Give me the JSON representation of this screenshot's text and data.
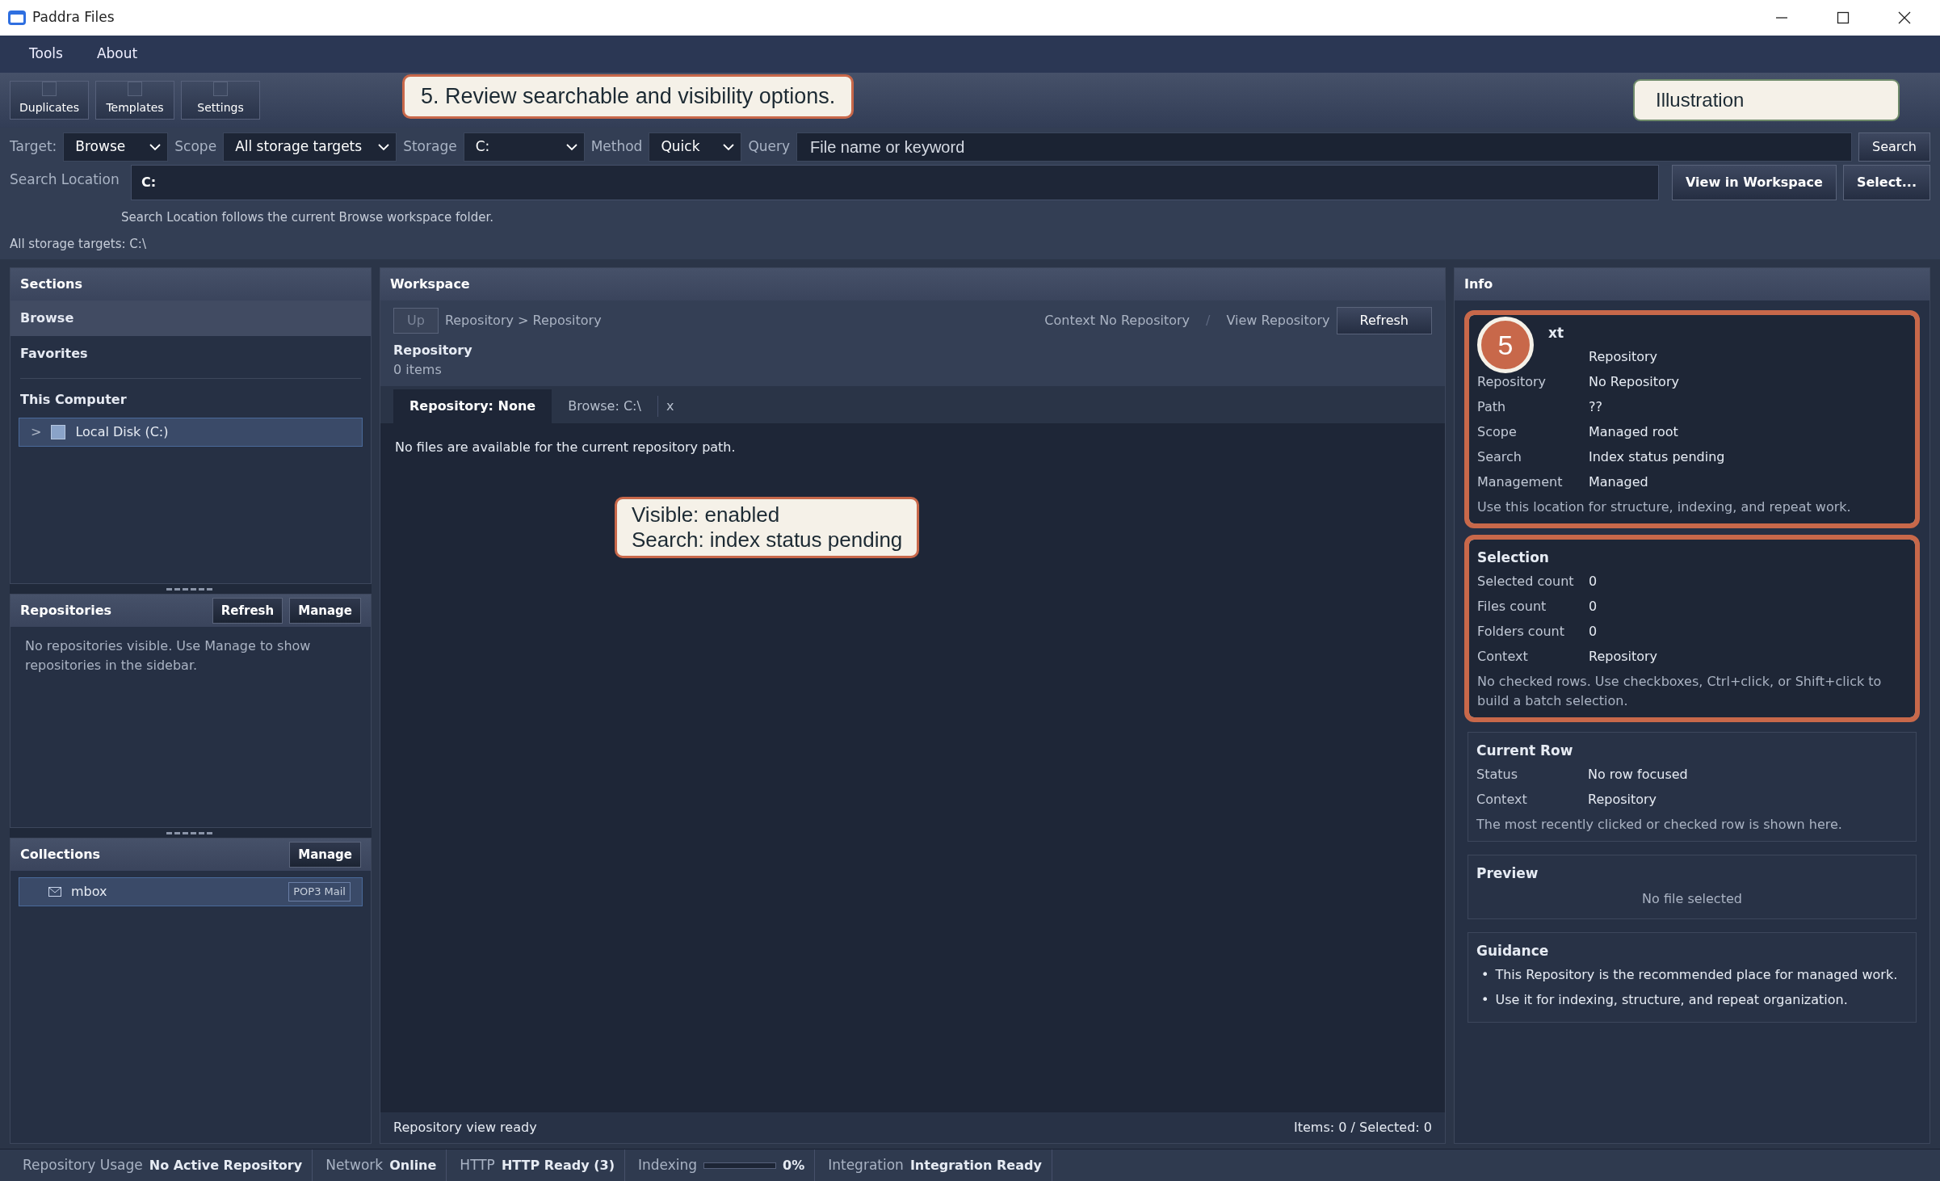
{
  "window": {
    "title": "Paddra Files"
  },
  "menu": [
    "Tools",
    "About"
  ],
  "toolbar": [
    "Duplicates",
    "Templates",
    "Settings"
  ],
  "tutorial_step": "5. Review searchable and visibility options.",
  "illustration_label": "Illustration",
  "search_bar": {
    "fields": [
      {
        "label": "Target:",
        "value": "Browse"
      },
      {
        "label": "Scope",
        "value": "All storage targets"
      },
      {
        "label": "Storage",
        "value": "C:"
      },
      {
        "label": "Method",
        "value": "Quick"
      }
    ],
    "query": {
      "label": "Query",
      "placeholder": "File name or keyword"
    },
    "search_button": "Search"
  },
  "location": {
    "label": "Search Location",
    "value": "C:",
    "buttons": [
      "View in Workspace",
      "Select..."
    ],
    "hint": "Search Location follows the current Browse workspace folder.",
    "summary": "All storage targets: C:\\"
  },
  "sidebar": {
    "sections": {
      "title": "Sections",
      "items": [
        {
          "label": "Browse",
          "selected": true
        },
        {
          "label": "Favorites",
          "selected": false
        }
      ],
      "group": "This Computer",
      "tree": [
        {
          "toggle": ">",
          "label": "Local Disk (C:)",
          "selected": true
        }
      ]
    },
    "repositories": {
      "title": "Repositories",
      "buttons": [
        "Refresh",
        "Manage"
      ],
      "empty": "No repositories visible. Use Manage to show repositories in the sidebar."
    },
    "collections": {
      "title": "Collections",
      "buttons": [
        "Manage"
      ],
      "items": [
        {
          "label": "mbox",
          "tag": "POP3 Mail"
        }
      ]
    }
  },
  "workspace": {
    "title": "Workspace",
    "up_button": {
      "label": "Up",
      "disabled": true
    },
    "breadcrumb": "Repository > Repository",
    "context": "Context No Repository",
    "separator": "/",
    "view": "View Repository",
    "refresh": "Refresh",
    "heading": "Repository",
    "count": "0 items",
    "tabs": [
      {
        "label": "Repository: None",
        "selected": true
      },
      {
        "label": "Browse: C:\\",
        "selected": false
      }
    ],
    "tab_close": "x",
    "empty": "No files are available for the current repository path.",
    "note": [
      "Visible: enabled",
      "Search: index status pending"
    ],
    "footer_left": "Repository view ready",
    "footer_right": "Items: 0 / Selected: 0"
  },
  "info": {
    "title": "Info",
    "step_marker": "5",
    "cards": [
      {
        "kind": "table",
        "title": "xt",
        "highlighted": true,
        "rows": [
          {
            "value": "Repository"
          },
          {
            "label": "Repository",
            "value": "No Repository"
          },
          {
            "label": "Path",
            "value": "??"
          },
          {
            "label": "Scope",
            "value": "Managed root"
          },
          {
            "label": "Search",
            "value": "Index status pending"
          },
          {
            "label": "Management",
            "value": "Managed"
          }
        ],
        "note": "Use this location for structure, indexing, and repeat work."
      },
      {
        "kind": "table",
        "title": "Selection",
        "highlighted": true,
        "rows": [
          {
            "label": "Selected count",
            "value": "0"
          },
          {
            "label": "Files count",
            "value": "0"
          },
          {
            "label": "Folders count",
            "value": "0"
          },
          {
            "label": "Context",
            "value": "Repository"
          }
        ],
        "note": "No checked rows. Use checkboxes, Ctrl+click, or Shift+click to build a batch selection."
      },
      {
        "kind": "table",
        "title": "Current Row",
        "highlighted": false,
        "rows": [
          {
            "label": "Status",
            "value": "No row focused"
          },
          {
            "label": "Context",
            "value": "Repository"
          }
        ],
        "note": "The most recently clicked or checked row is shown here."
      },
      {
        "kind": "preview",
        "title": "Preview",
        "text": "No file selected"
      },
      {
        "kind": "bullets",
        "title": "Guidance",
        "items": [
          {
            "marker": "•",
            "text": "This Repository is the recommended place for managed work."
          },
          {
            "marker": "•",
            "text": "Use it for indexing, structure, and repeat organization."
          }
        ]
      }
    ]
  },
  "status_bar": [
    {
      "kind": "text",
      "label": "Repository Usage",
      "value": "No Active Repository"
    },
    {
      "kind": "text",
      "label": "Network",
      "value": "Online"
    },
    {
      "kind": "text",
      "label": "HTTP",
      "value": "HTTP Ready (3)"
    },
    {
      "kind": "meter",
      "label": "Indexing",
      "level": 0,
      "value": "0%"
    },
    {
      "kind": "text",
      "label": "Integration",
      "value": "Integration Ready"
    }
  ]
}
